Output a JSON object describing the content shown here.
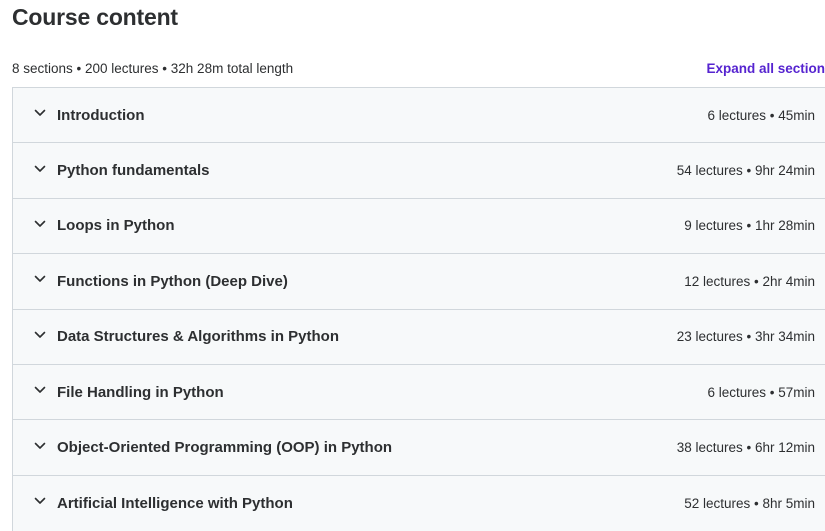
{
  "header": {
    "title": "Course content",
    "summary": "8 sections • 200 lectures • 32h 28m total length",
    "expand_label": "Expand all section"
  },
  "sections": [
    {
      "title": "Introduction",
      "meta": "6 lectures • 45min"
    },
    {
      "title": "Python fundamentals",
      "meta": "54 lectures • 9hr 24min"
    },
    {
      "title": "Loops in Python",
      "meta": "9 lectures • 1hr 28min"
    },
    {
      "title": "Functions in Python (Deep Dive)",
      "meta": "12 lectures • 2hr 4min"
    },
    {
      "title": "Data Structures & Algorithms in Python",
      "meta": "23 lectures • 3hr 34min"
    },
    {
      "title": "File Handling in Python",
      "meta": "6 lectures • 57min"
    },
    {
      "title": "Object-Oriented Programming (OOP) in Python",
      "meta": "38 lectures • 6hr 12min"
    },
    {
      "title": "Artificial Intelligence with Python",
      "meta": "52 lectures • 8hr 5min"
    }
  ],
  "icons": {
    "section_toggle": "chevron-down-icon"
  },
  "colors": {
    "accent": "#5624d0",
    "text": "#2d2f31",
    "section_bg": "#f7f9fa",
    "border": "#d1d7dc"
  }
}
